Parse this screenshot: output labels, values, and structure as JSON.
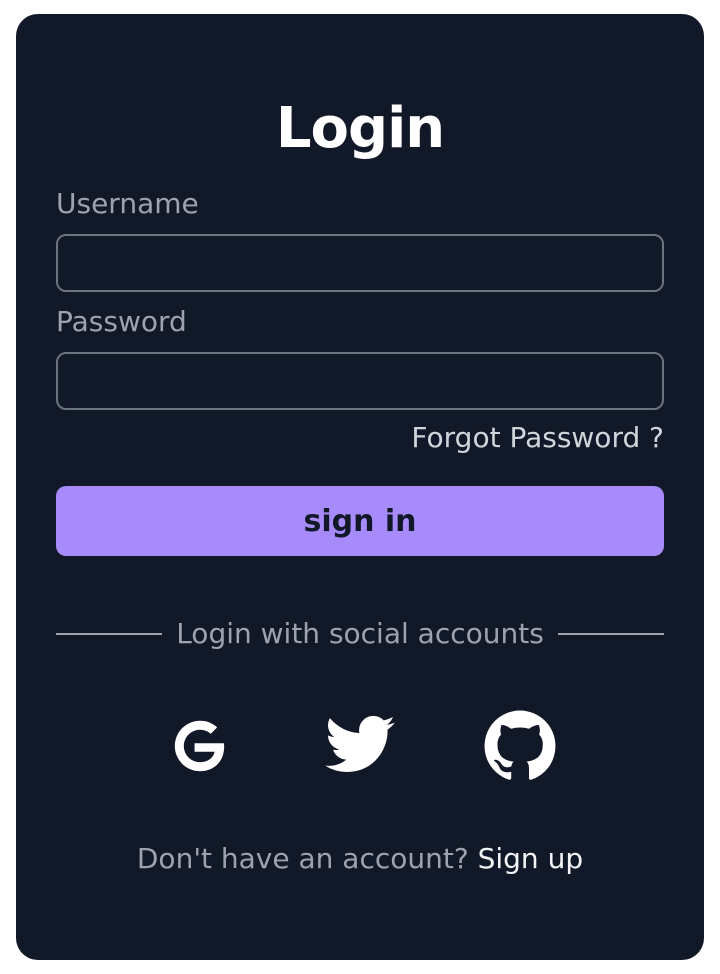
{
  "login": {
    "title": "Login",
    "username_label": "Username",
    "username_value": "",
    "password_label": "Password",
    "password_value": "",
    "forgot_password": "Forgot Password ?",
    "signin_label": "sign in",
    "social_divider": "Login with social accounts",
    "social_icons": [
      "google-icon",
      "twitter-icon",
      "github-icon"
    ],
    "signup_prompt": "Don't have an account?",
    "signup_link": "Sign up"
  },
  "colors": {
    "page_bg": "#ffffff",
    "card_bg": "#111827",
    "accent": "#a78bfa",
    "muted_text": "#9ca3af",
    "text": "#f3f4f6"
  }
}
